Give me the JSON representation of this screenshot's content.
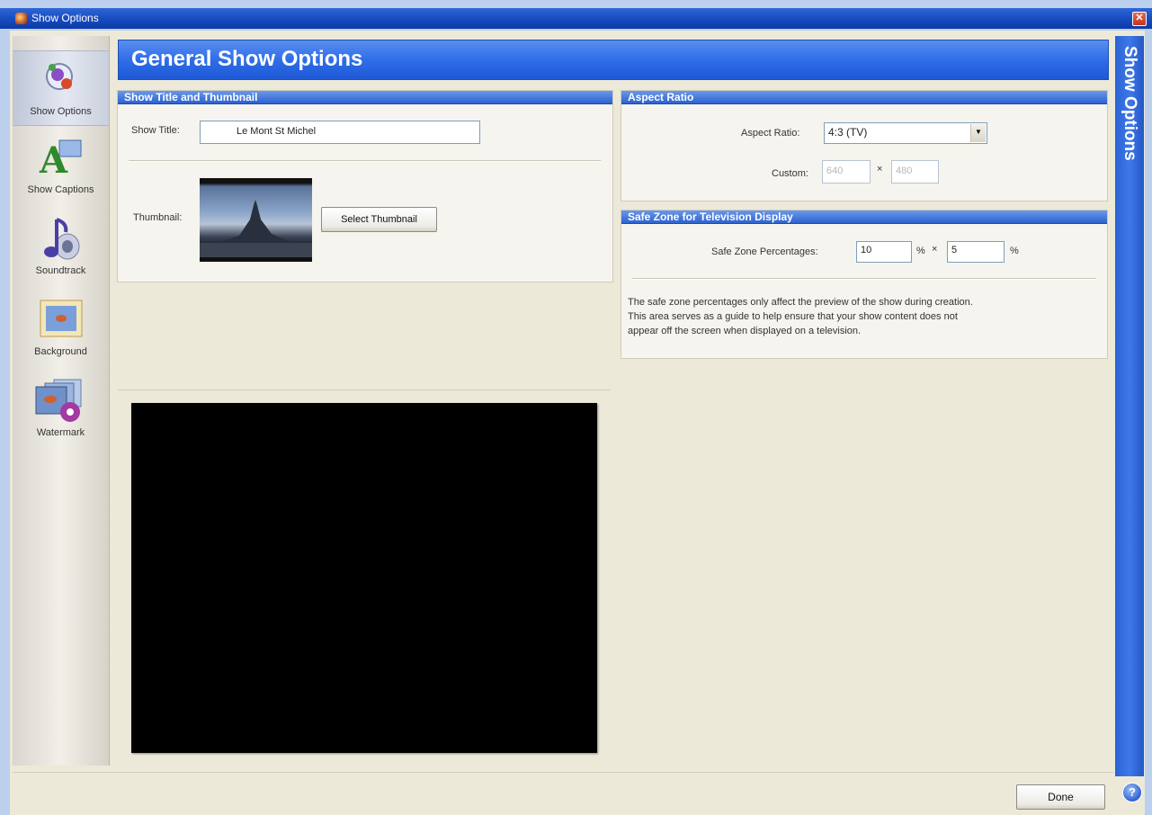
{
  "window": {
    "title": "Show Options",
    "close_glyph": "✕"
  },
  "sidebar": {
    "items": [
      {
        "label": "Show Options",
        "icon": "show-options-icon",
        "selected": true
      },
      {
        "label": "Show Captions",
        "icon": "captions-icon",
        "selected": false
      },
      {
        "label": "Soundtrack",
        "icon": "music-note-icon",
        "selected": false
      },
      {
        "label": "Background",
        "icon": "background-image-icon",
        "selected": false
      },
      {
        "label": "Watermark",
        "icon": "watermark-icon",
        "selected": false
      }
    ]
  },
  "header": {
    "title": "General Show Options"
  },
  "right_sidebar": {
    "title": "Show Options"
  },
  "title_thumbnail": {
    "heading": "Show Title and Thumbnail",
    "show_title_label": "Show Title:",
    "show_title_value": "Le Mont St Michel",
    "thumbnail_label": "Thumbnail:",
    "select_thumbnail_button": "Select Thumbnail"
  },
  "aspect_ratio": {
    "heading": "Aspect Ratio",
    "label": "Aspect Ratio:",
    "selected": "4:3 (TV)",
    "custom_label": "Custom:",
    "custom_width": "640",
    "custom_height": "480",
    "times": "×"
  },
  "safe_zone": {
    "heading": "Safe Zone for Television Display",
    "label": "Safe Zone Percentages:",
    "horizontal": "10",
    "vertical": "5",
    "percent": "%",
    "times": "×",
    "description_lines": [
      "The safe zone percentages only affect the preview of the show during creation.",
      "This area serves as a guide to help ensure that your show content does not",
      "appear off the screen when displayed on a television."
    ]
  },
  "footer": {
    "done_button": "Done",
    "help_glyph": "?"
  },
  "colors": {
    "accent": "#2f6ee8",
    "panel": "#f5f4ee",
    "window": "#ece9d8"
  }
}
